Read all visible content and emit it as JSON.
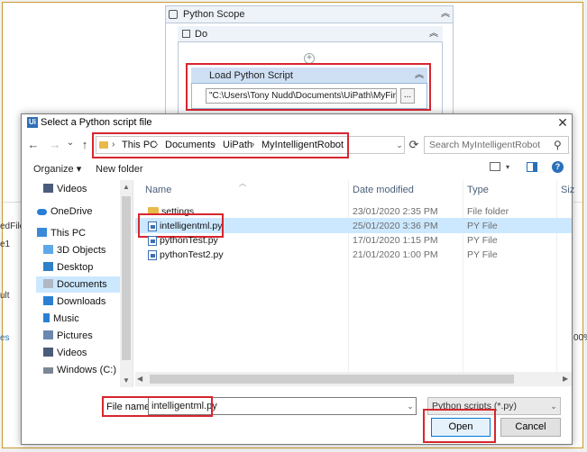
{
  "designer": {
    "scope_title": "Python Scope",
    "do_title": "Do",
    "load_script_title": "Load Python Script",
    "load_script_path": "\"C:\\Users\\Tony Nudd\\Documents\\UiPath\\MyFirstF",
    "browse_label": "...",
    "side_fragments": [
      "edFile",
      "e1",
      "ult",
      "es"
    ],
    "right_fragment": "00%",
    "colors": {
      "highlight": "#d7262e",
      "activity_header": "#cfe0f5"
    }
  },
  "dialog": {
    "app_icon_text": "Ui",
    "title": "Select a Python script file",
    "close": "✕",
    "nav": {
      "back": "←",
      "forward": "→",
      "recent": "⌄",
      "up": "↑"
    },
    "breadcrumbs": [
      "This PC",
      "Documents",
      "UiPath",
      "MyIntelligentRobot"
    ],
    "address_dropdown": "⌄",
    "refresh": "⟳",
    "search_placeholder": "Search MyIntelligentRobot",
    "toolbar": {
      "organize": "Organize ▾",
      "new_folder": "New folder",
      "help": "?"
    },
    "nav_pane": [
      {
        "label": "Videos",
        "icon": "videos-icon"
      },
      {
        "label": "OneDrive",
        "icon": "cloud-icon"
      },
      {
        "label": "This PC",
        "icon": "computer-icon"
      },
      {
        "label": "3D Objects",
        "icon": "cube-icon"
      },
      {
        "label": "Desktop",
        "icon": "desktop-icon"
      },
      {
        "label": "Documents",
        "icon": "documents-icon"
      },
      {
        "label": "Downloads",
        "icon": "download-icon"
      },
      {
        "label": "Music",
        "icon": "music-icon"
      },
      {
        "label": "Pictures",
        "icon": "pictures-icon"
      },
      {
        "label": "Videos",
        "icon": "videos-icon"
      },
      {
        "label": "Windows (C:)",
        "icon": "drive-icon"
      }
    ],
    "columns": {
      "name": "Name",
      "date": "Date modified",
      "type": "Type",
      "size": "Siz"
    },
    "files": [
      {
        "name": "settings",
        "date": "23/01/2020 2:35 PM",
        "type": "File folder",
        "kind": "folder"
      },
      {
        "name": "intelligentml.py",
        "date": "25/01/2020 3:36 PM",
        "type": "PY File",
        "kind": "py"
      },
      {
        "name": "pythonTest.py",
        "date": "17/01/2020 1:15 PM",
        "type": "PY File",
        "kind": "py"
      },
      {
        "name": "pythonTest2.py",
        "date": "21/01/2020 1:00 PM",
        "type": "PY File",
        "kind": "py"
      }
    ],
    "file_name_label": "File name:",
    "file_name_value": "intelligentml.py",
    "file_type_value": "Python scripts (*.py)",
    "open_label": "Open",
    "cancel_label": "Cancel"
  }
}
